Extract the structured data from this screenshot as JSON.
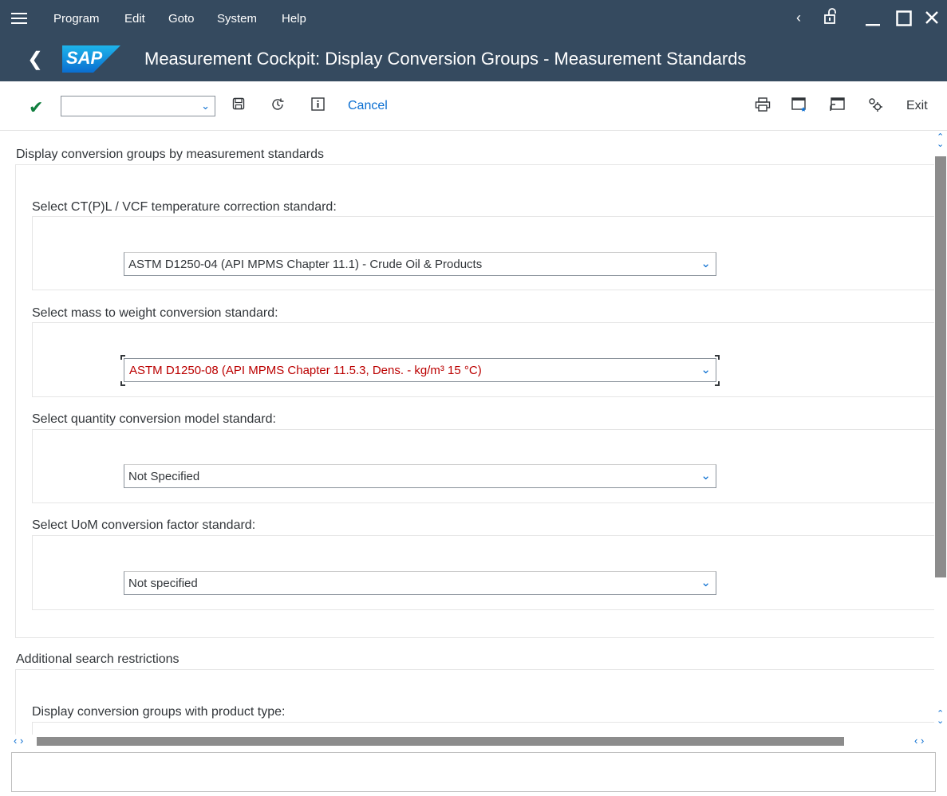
{
  "menu": {
    "items": [
      {
        "label": "Program"
      },
      {
        "label": "Edit"
      },
      {
        "label": "Goto"
      },
      {
        "label": "System"
      },
      {
        "label": "Help"
      }
    ]
  },
  "window": {
    "title": "Measurement Cockpit: Display Conversion Groups - Measurement Standards",
    "logo_text": "SAP"
  },
  "toolbar": {
    "command_field_value": "",
    "cancel_label": "Cancel",
    "exit_label": "Exit",
    "icons": [
      "save-icon",
      "history-icon",
      "info-icon",
      "print-icon",
      "new-session-icon",
      "generate-shortcut-icon",
      "customize-icon"
    ]
  },
  "sections": {
    "standards": {
      "title": "Display conversion groups by measurement standards",
      "fields": [
        {
          "label": "Select CT(P)L / VCF temperature correction standard:",
          "value": "ASTM D1250-04 (API MPMS Chapter 11.1) - Crude Oil & Products"
        },
        {
          "label": "Select mass to weight conversion standard:",
          "value": "ASTM D1250-08 (API MPMS Chapter 11.5.3, Dens. - kg/m³ 15 °C)"
        },
        {
          "label": "Select quantity conversion model standard:",
          "value": "Not Specified"
        },
        {
          "label": "Select UoM conversion factor standard:",
          "value": "Not specified"
        }
      ]
    },
    "restrictions": {
      "title": "Additional search restrictions",
      "fields": [
        {
          "label": "Display conversion groups with product type:"
        }
      ]
    }
  },
  "colors": {
    "shell": "#354a5f",
    "accent": "#0a6ed1",
    "focused_text": "#bb0000",
    "confirm": "#107e3e"
  },
  "statusbar": {
    "text": ""
  }
}
